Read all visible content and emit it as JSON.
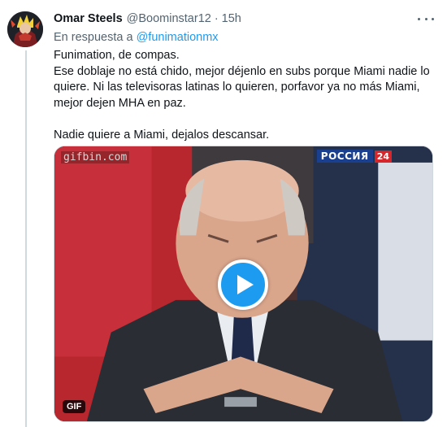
{
  "tweet": {
    "author_name": "Omar Steels",
    "author_handle": "@Boominstar12",
    "separator": "·",
    "time": "15h",
    "reply_prefix": "En respuesta a",
    "reply_to": "@funimationmx",
    "text_lines": [
      "Funimation, de compas.",
      "Ese doblaje no está chido, mejor déjenlo en subs porque Miami nadie lo quiere. Ni las televisoras latinas lo quieren, porfavor ya no más Miami, mejor dejen MHA en paz.",
      "Nadie quiere a Miami, dejalos descansar."
    ]
  },
  "media": {
    "watermark": "gifbin.com",
    "channel_name": "РОССИЯ",
    "channel_number": "24",
    "badge": "GIF"
  },
  "colors": {
    "accent": "#1d9bf0",
    "muted": "#536471",
    "text": "#0f1419"
  },
  "icons": {
    "more": "more-horizontal-icon",
    "play": "play-icon"
  }
}
